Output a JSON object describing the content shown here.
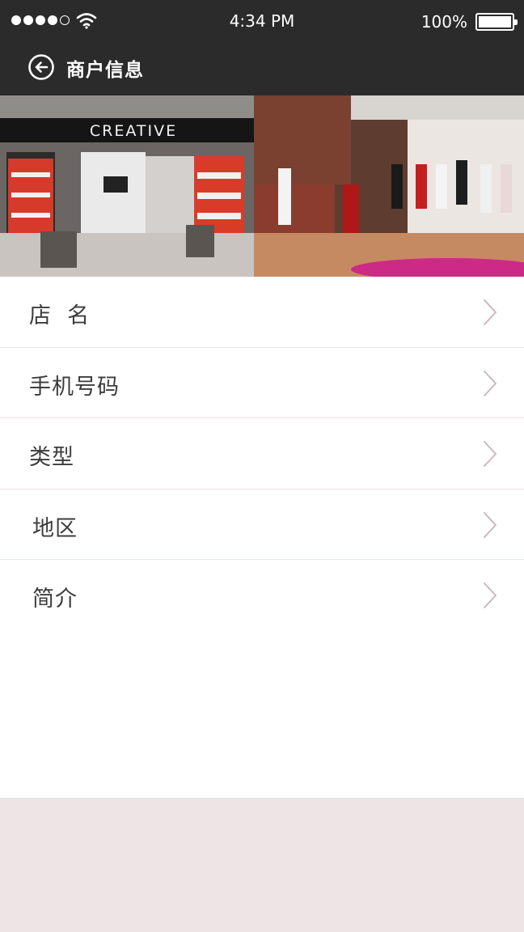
{
  "status_bar": {
    "time": "4:34 PM",
    "battery": "100%"
  },
  "header": {
    "title": "商户信息"
  },
  "photos": {
    "store_sign": "CREATIVE"
  },
  "list_items": [
    {
      "label": "店  名"
    },
    {
      "label": "手机号码"
    },
    {
      "label": "类型"
    },
    {
      "label": "地区"
    },
    {
      "label": "简介"
    }
  ],
  "icons": {
    "back": "back-arrow-icon",
    "chevron": "chevron-right-icon",
    "wifi": "wifi-icon",
    "battery": "battery-icon"
  },
  "colors": {
    "header_bg": "#2b2b2b",
    "divider": "#f4dfe4",
    "chevron": "#c9b8bd",
    "footer_bg": "#efe4e5"
  }
}
